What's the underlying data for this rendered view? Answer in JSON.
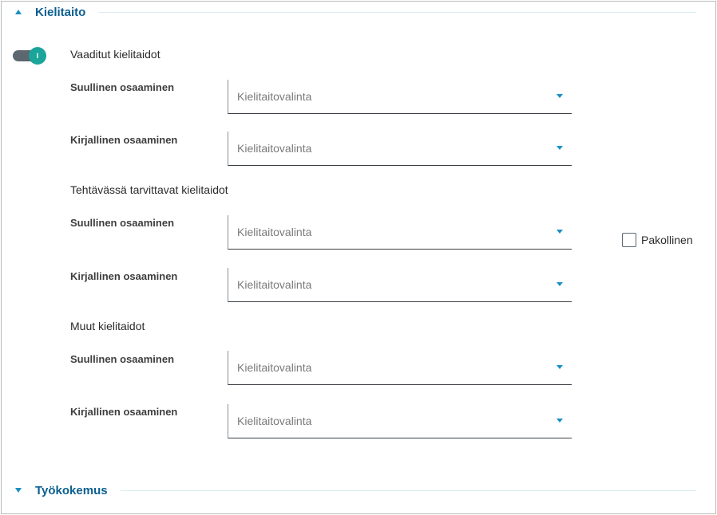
{
  "sections": {
    "language": {
      "title": "Kielitaito",
      "expanded": true
    },
    "work": {
      "title": "Työkokemus",
      "expanded": false
    }
  },
  "toggle": {
    "on": true,
    "knob_text": "I"
  },
  "groups": {
    "required": {
      "title": "Vaaditut kielitaidot",
      "oral": {
        "label": "Suullinen osaaminen",
        "placeholder": "Kielitaitovalinta"
      },
      "written": {
        "label": "Kirjallinen osaaminen",
        "placeholder": "Kielitaitovalinta"
      }
    },
    "task": {
      "title": "Tehtävässä tarvittavat kielitaidot",
      "oral": {
        "label": "Suullinen osaaminen",
        "placeholder": "Kielitaitovalinta"
      },
      "written": {
        "label": "Kirjallinen osaaminen",
        "placeholder": "Kielitaitovalinta"
      }
    },
    "other": {
      "title": "Muut kielitaidot",
      "oral": {
        "label": "Suullinen osaaminen",
        "placeholder": "Kielitaitovalinta"
      },
      "written": {
        "label": "Kirjallinen osaaminen",
        "placeholder": "Kielitaitovalinta"
      }
    }
  },
  "mandatory": {
    "label": "Pakollinen",
    "checked": false
  },
  "colors": {
    "accent": "#0a5f8f",
    "toggle_on": "#1aa49a",
    "arrow": "#1a8fc4"
  },
  "icons": {
    "expanded": "caret-up-icon",
    "collapsed": "caret-down-icon",
    "select": "chevron-down-icon"
  }
}
